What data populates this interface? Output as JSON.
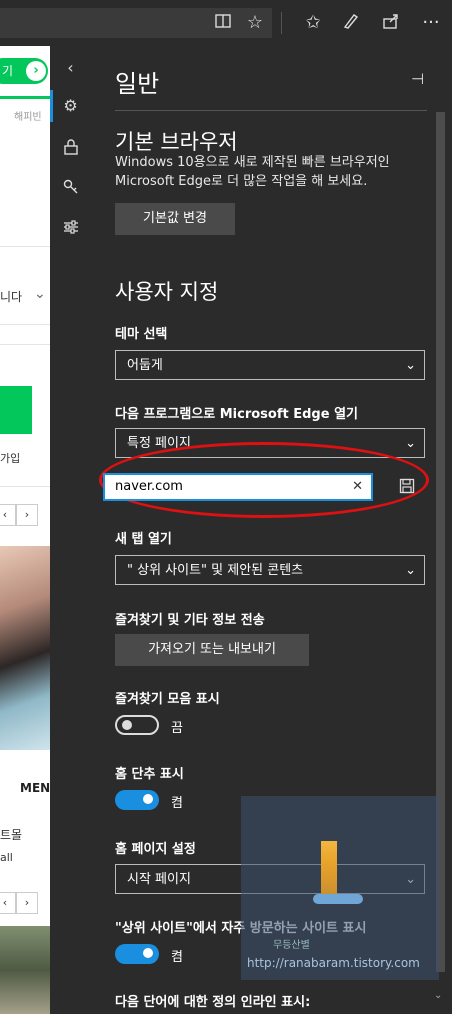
{
  "browser": {
    "icons": [
      "reading-view-icon",
      "star-icon",
      "favorites-hub-icon",
      "pen-icon",
      "share-icon",
      "more-icon"
    ],
    "more_label": "···"
  },
  "webpage": {
    "pill_label": "기",
    "happy_text": "해피빈",
    "dropdown_text": "니다",
    "join_text": "가입",
    "men_text": "MEN",
    "text_a": "트몰",
    "text_b": "all"
  },
  "rail": {
    "icons": [
      "back-icon",
      "settings-gear-icon",
      "lock-icon",
      "key-icon",
      "sliders-icon"
    ]
  },
  "settings": {
    "title": "일반",
    "pin_icon": "pin-icon",
    "default_browser": {
      "heading": "기본 브라우저",
      "description": "Windows 10용으로 새로 제작된 빠른 브라우저인 Microsoft Edge로 더 많은 작업을 해 보세요.",
      "button": "기본값 변경"
    },
    "customize": {
      "heading": "사용자 지정",
      "theme_label": "테마 선택",
      "theme_value": "어둡게",
      "open_with_label": "다음 프로그램으로 Microsoft Edge 열기",
      "open_with_value": "특정 페이지",
      "url_value": "naver.com",
      "new_tab_label": "새 탭 열기",
      "new_tab_value": "\" 상위 사이트\"  및 제안된 콘텐츠",
      "favorites_transfer_label": "즐겨찾기 및 기타 정보 전송",
      "import_button": "가져오기 또는 내보내기",
      "favorites_bar_label": "즐겨찾기 모음 표시",
      "favorites_bar_state": "끔",
      "home_button_label": "홈 단추 표시",
      "home_button_state": "켬",
      "home_page_label": "홈 페이지 설정",
      "home_page_value": "시작 페이지",
      "top_sites_label": "\"상위 사이트\"에서 자주 방문하는 사이트 표시",
      "top_sites_state": "켬",
      "inline_def_label": "다음 단어에 대한 정의 인라인 표시:"
    }
  },
  "watermark": {
    "title": "무등산별",
    "url": "http://ranabaram.tistory.com"
  }
}
